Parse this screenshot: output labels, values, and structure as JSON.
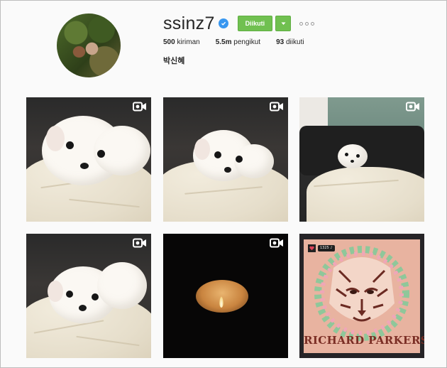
{
  "profile": {
    "username": "ssinz7",
    "full_name": "박신혜",
    "verified": true,
    "follow_label": "Diikuti"
  },
  "stats": {
    "posts_count": "500",
    "posts_label": "kiriman",
    "followers_count": "5.5m",
    "followers_label": "pengikut",
    "following_count": "93",
    "following_label": "diikuti"
  },
  "posts": [
    {
      "kind": "video",
      "subject": "white puppy on blanket"
    },
    {
      "kind": "video",
      "subject": "white puppy on blanket"
    },
    {
      "kind": "video",
      "subject": "white puppy on sofa"
    },
    {
      "kind": "video",
      "subject": "white puppy on blanket"
    },
    {
      "kind": "video",
      "subject": "candle in dark"
    },
    {
      "kind": "image",
      "subject": "tiger poster"
    }
  ],
  "poster": {
    "caption": "RICHARD PARKERS",
    "tag": "1325 ♪"
  },
  "colors": {
    "follow_green": "#70c050",
    "verified_blue": "#3897f0",
    "page_bg": "#fafafa"
  }
}
